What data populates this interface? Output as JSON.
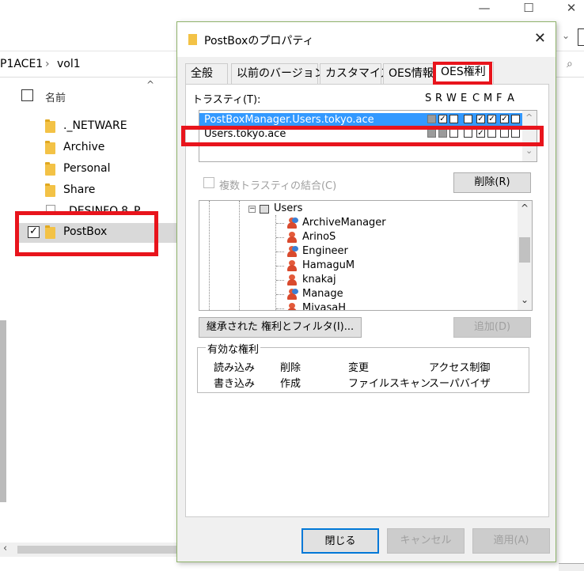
{
  "explorer": {
    "window_controls": {
      "minimize": "—",
      "maximize": "☐",
      "close": "✕"
    },
    "breadcrumb": [
      "P1ACE1",
      "vol1"
    ],
    "column_header": "名前",
    "files": [
      {
        "name": "._NETWARE",
        "type": "folder",
        "checked": false
      },
      {
        "name": "Archive",
        "type": "folder",
        "checked": false
      },
      {
        "name": "Personal",
        "type": "folder",
        "checked": false
      },
      {
        "name": "Share",
        "type": "folder",
        "checked": false
      },
      {
        "name": "_DESINFO.8_P",
        "type": "file",
        "checked": false
      },
      {
        "name": "PostBox",
        "type": "folder",
        "checked": true
      }
    ]
  },
  "dialog": {
    "title": "PostBoxのプロパティ",
    "close": "✕",
    "tabs": [
      "全般",
      "以前のバージョン",
      "カスタマイズ",
      "OES情報",
      "OES権利"
    ],
    "selected_tab": "OES権利",
    "trustee_label": "トラスティ(T):",
    "rights_header": [
      "S",
      "R",
      "W",
      "E",
      "C",
      "M",
      "F",
      "A"
    ],
    "trustees": [
      {
        "name": "PostBoxManager.Users.tokyo.ace",
        "selected": true,
        "rights": [
          "gray",
          "on",
          "off",
          "off",
          "on",
          "on",
          "on",
          "off"
        ]
      },
      {
        "name": "Users.tokyo.ace",
        "selected": false,
        "rights": [
          "gray",
          "gray",
          "off",
          "off",
          "on",
          "off",
          "off",
          "off"
        ]
      }
    ],
    "combine_checkbox": "複数トラスティの結合(C)",
    "delete_button": "削除(R)",
    "tree_root": "Users",
    "tree_items": [
      "ArchiveManager",
      "ArinoS",
      "Engineer",
      "HamaguM",
      "knakaj",
      "Manage",
      "MiyasaH"
    ],
    "tree_group_items": [
      "ArchiveManager",
      "Engineer",
      "Manage"
    ],
    "inherited_button": "継承された 権利とフィルタ(I)...",
    "add_button": "追加(D)",
    "effective_rights": {
      "label": "有効な権利",
      "items": [
        [
          "読み込み",
          "削除",
          "変更",
          "アクセス制御"
        ],
        [
          "書き込み",
          "作成",
          "ファイルスキャン",
          "スーパバイザ"
        ]
      ]
    },
    "ok_button": "閉じる",
    "cancel_button": "キャンセル",
    "apply_button": "適用(A)"
  },
  "colors": {
    "highlight": "#e8141c",
    "selection": "#3399ff",
    "folder": "#f3c246"
  }
}
